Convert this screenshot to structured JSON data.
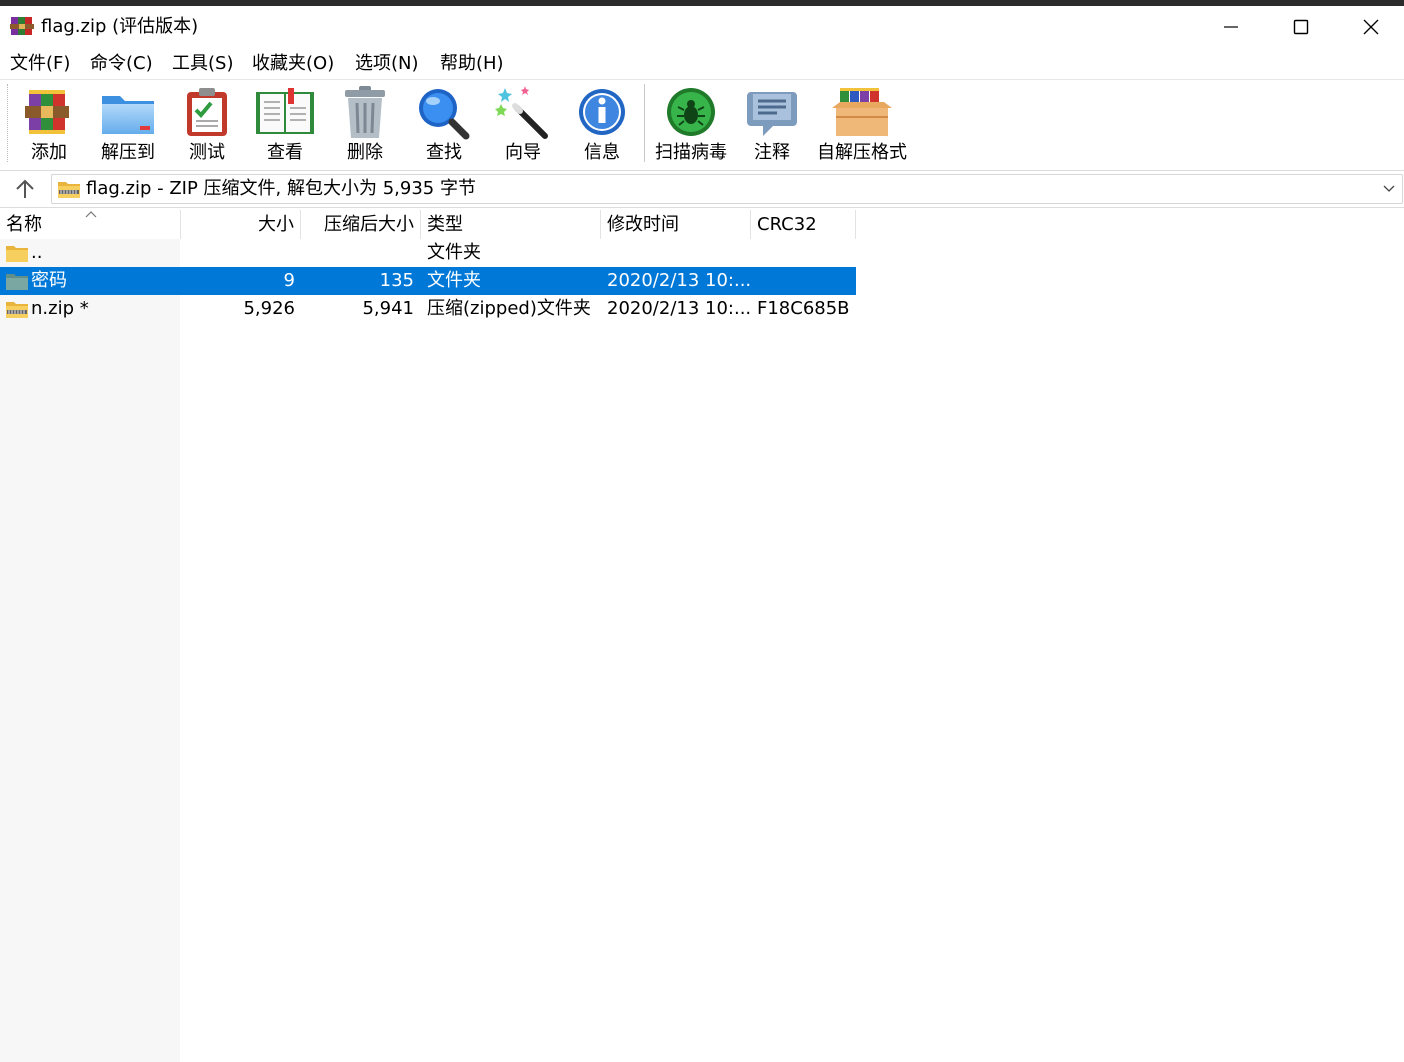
{
  "window": {
    "title": "flag.zip (评估版本)"
  },
  "menu": [
    "文件(F)",
    "命令(C)",
    "工具(S)",
    "收藏夹(O)",
    "选项(N)",
    "帮助(H)"
  ],
  "toolbar": {
    "add": "添加",
    "extract_to": "解压到",
    "test": "测试",
    "view": "查看",
    "delete": "删除",
    "find": "查找",
    "wizard": "向导",
    "info": "信息",
    "virus_scan": "扫描病毒",
    "comment": "注释",
    "sfx": "自解压格式"
  },
  "address": {
    "text": "flag.zip - ZIP 压缩文件, 解包大小为 5,935 字节"
  },
  "columns": {
    "name": "名称",
    "size": "大小",
    "packed": "压缩后大小",
    "type": "类型",
    "modified": "修改时间",
    "crc": "CRC32"
  },
  "files": [
    {
      "name": "..",
      "size": "",
      "packed": "",
      "type": "文件夹",
      "modified": "",
      "crc": "",
      "icon": "folder-up-icon"
    },
    {
      "name": "密码",
      "size": "9",
      "packed": "135",
      "type": "文件夹",
      "modified": "2020/2/13 10:...",
      "crc": "",
      "icon": "folder-icon",
      "selected": true
    },
    {
      "name": "n.zip *",
      "size": "5,926",
      "packed": "5,941",
      "type": "压缩(zipped)文件夹",
      "modified": "2020/2/13 10:...",
      "crc": "F18C685B",
      "icon": "zip-file-icon"
    }
  ],
  "colors": {
    "selection": "#0078d7",
    "folder": "#f6c343"
  }
}
